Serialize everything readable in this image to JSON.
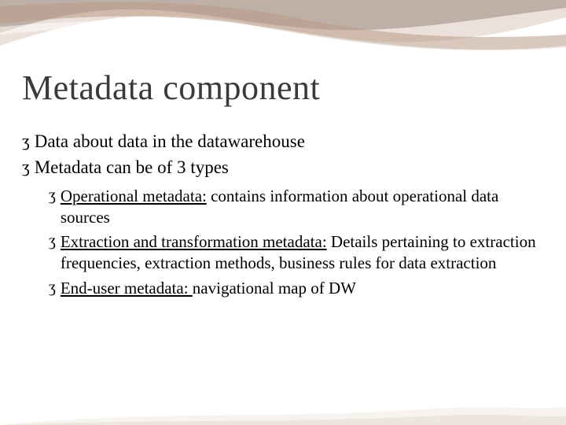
{
  "title": "Metadata component",
  "bullets": {
    "b1": "Data about data in the datawarehouse",
    "b2": "Metadata can be of 3 types",
    "s1_u": "Operational metadata:",
    "s1_rest": " contains information about operational data sources",
    "s2_u": "Extraction and transformation metadata:",
    "s2_rest": " Details pertaining to extraction  frequencies, extraction methods, business rules for data extraction",
    "s3_u": "End-user metadata: ",
    "s3_rest": "navigational map of DW"
  },
  "glyphs": {
    "scribble": "ʒ"
  }
}
